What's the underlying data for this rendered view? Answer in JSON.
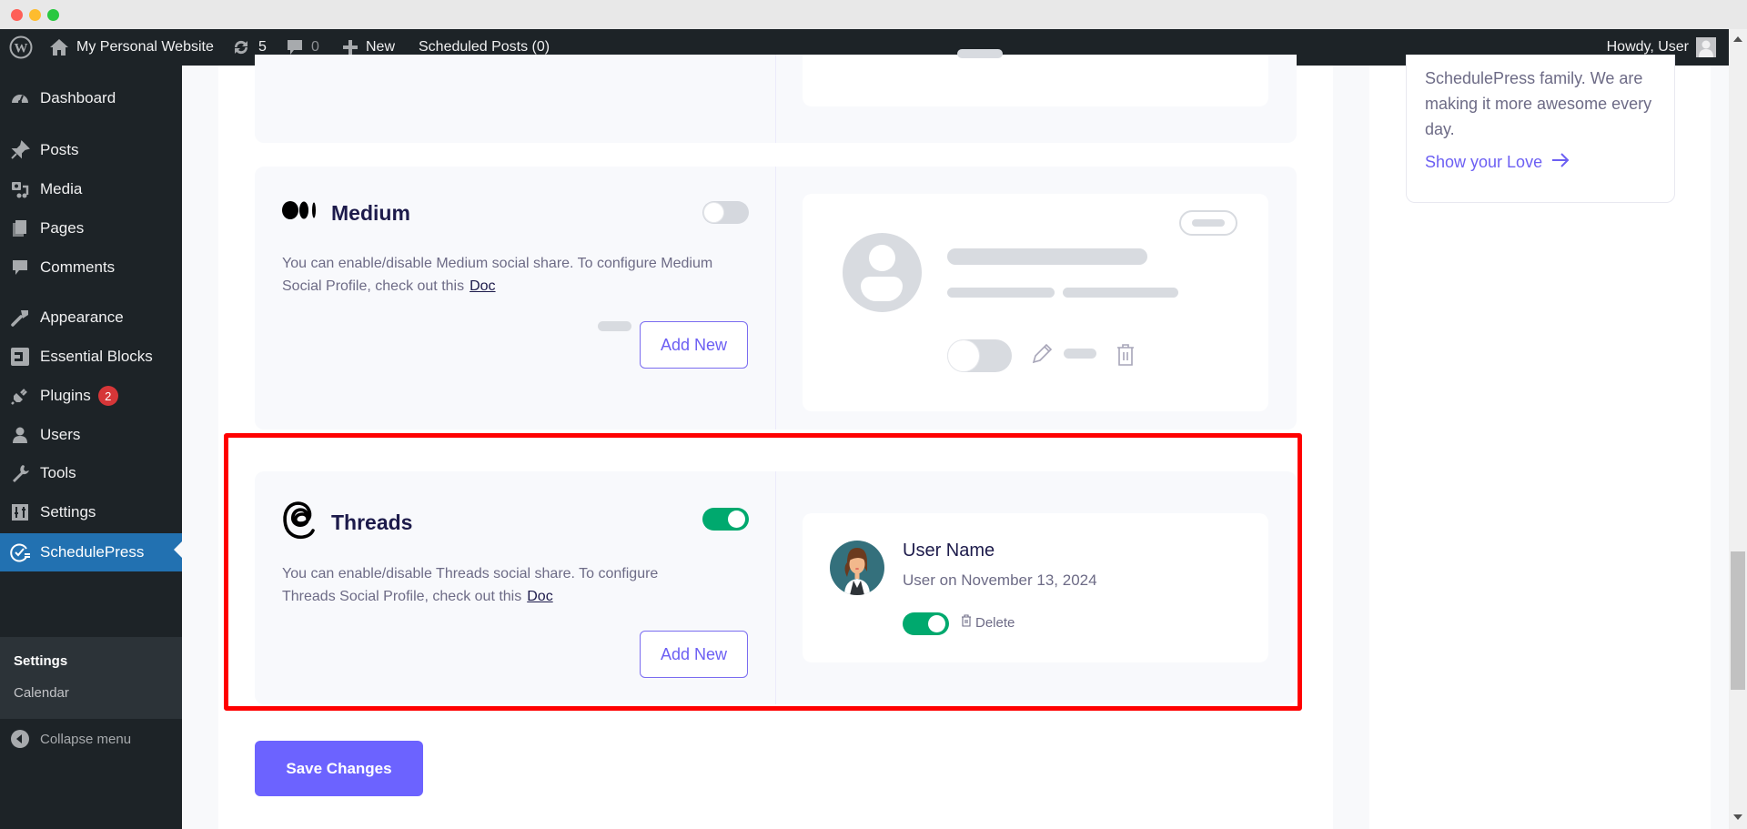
{
  "admin_bar": {
    "site_name": "My Personal Website",
    "updates_count": "5",
    "comments_count": "0",
    "new_label": "New",
    "scheduled_posts": "Scheduled Posts (0)",
    "greeting": "Howdy, User"
  },
  "sidebar": {
    "items": [
      {
        "label": "Dashboard",
        "icon": "dashboard-icon"
      },
      {
        "label": "Posts",
        "icon": "pin-icon"
      },
      {
        "label": "Media",
        "icon": "media-icon"
      },
      {
        "label": "Pages",
        "icon": "pages-icon"
      },
      {
        "label": "Comments",
        "icon": "comment-icon"
      },
      {
        "label": "Appearance",
        "icon": "brush-icon"
      },
      {
        "label": "Essential Blocks",
        "icon": "essential-blocks-icon"
      },
      {
        "label": "Plugins",
        "icon": "plug-icon",
        "badge": "2"
      },
      {
        "label": "Users",
        "icon": "user-icon"
      },
      {
        "label": "Tools",
        "icon": "wrench-icon"
      },
      {
        "label": "Settings",
        "icon": "sliders-icon"
      },
      {
        "label": "SchedulePress",
        "icon": "schedulepress-icon",
        "active": true
      }
    ],
    "submenu": [
      {
        "label": "Settings",
        "current": true
      },
      {
        "label": "Calendar"
      }
    ],
    "collapse_label": "Collapse menu"
  },
  "medium": {
    "title": "Medium",
    "enabled": false,
    "description": "You can enable/disable Medium social share. To configure Medium Social Profile, check out this",
    "doc_link": "Doc",
    "add_button": "Add New"
  },
  "threads": {
    "title": "Threads",
    "enabled": true,
    "description": "You can enable/disable Threads social share. To configure Threads Social Profile, check out this",
    "doc_link": "Doc",
    "add_button": "Add New",
    "profile": {
      "name": "User Name",
      "meta": "User on November 13, 2024",
      "enabled": true,
      "delete_label": "Delete"
    }
  },
  "save_button": "Save Changes",
  "love_card": {
    "text": "SchedulePress family. We are making it more awesome every day.",
    "link": "Show your Love"
  },
  "colors": {
    "accent": "#6c5ff3",
    "toggle_on": "#00a96e",
    "wp_active": "#2271b1",
    "highlight": "#ff0000"
  }
}
